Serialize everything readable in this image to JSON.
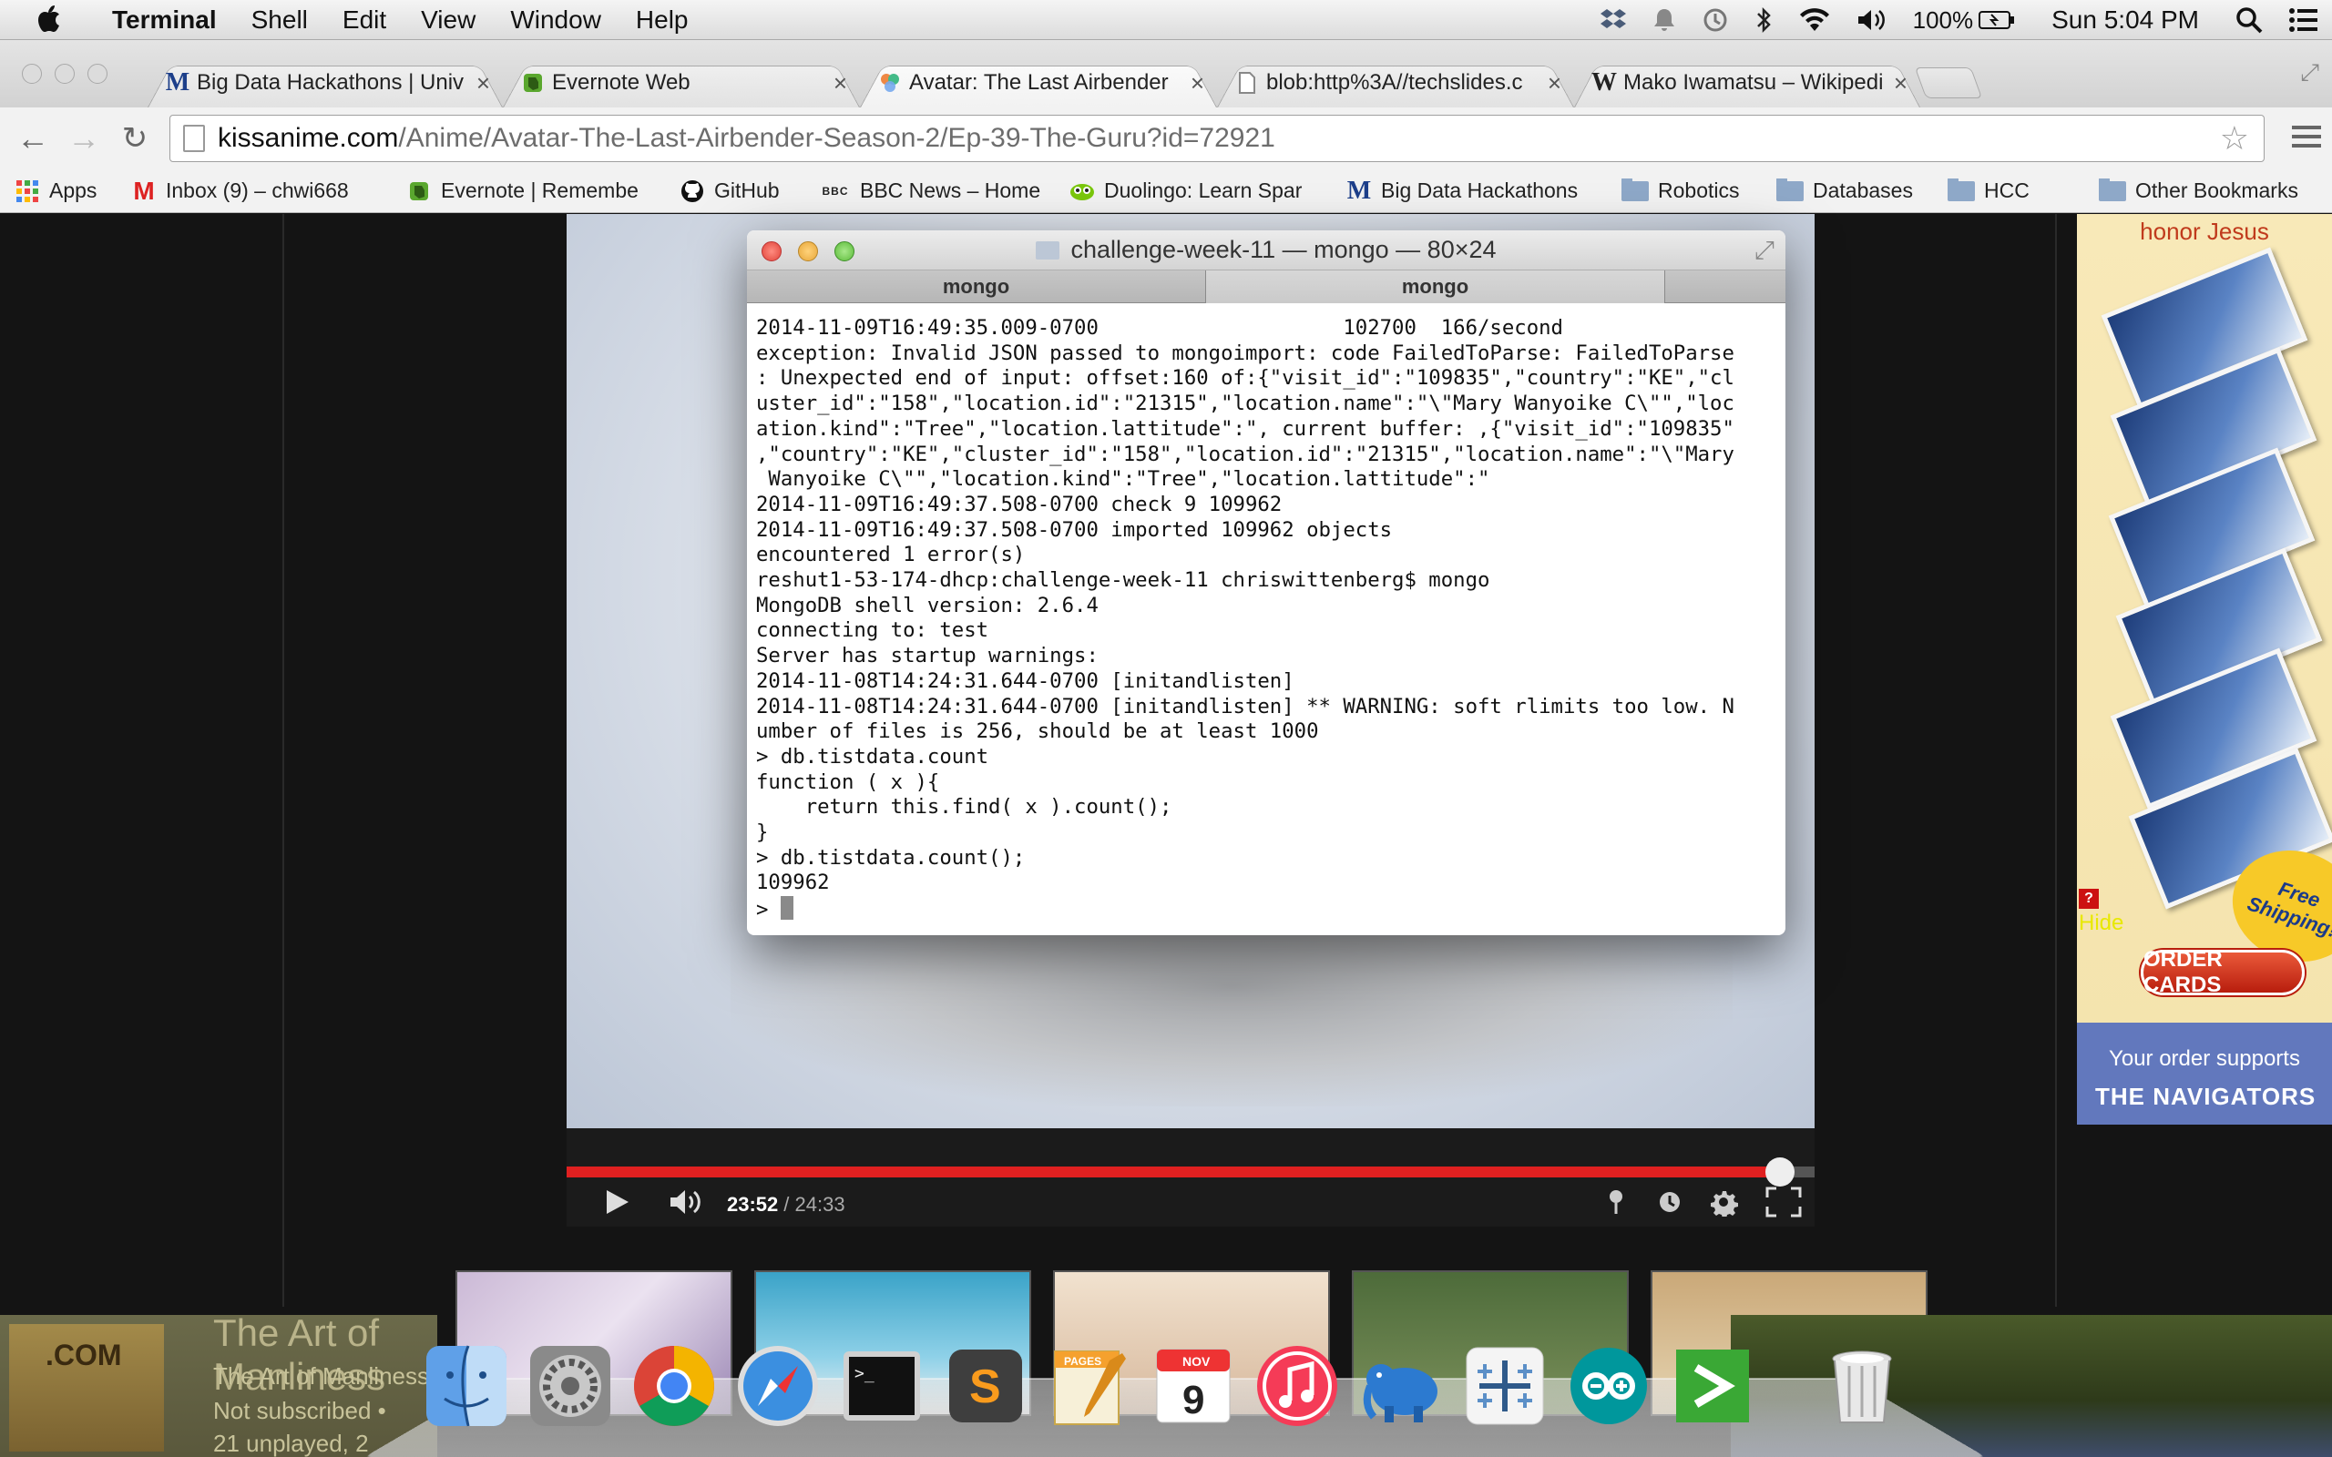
{
  "menubar": {
    "app_name": "Terminal",
    "menus": [
      "Shell",
      "Edit",
      "View",
      "Window",
      "Help"
    ],
    "battery": "100%",
    "clock": "Sun 5:04 PM"
  },
  "browser": {
    "tabs": [
      {
        "icon": "M",
        "title": "Big Data Hackathons | Univ"
      },
      {
        "icon": "evernote",
        "title": "Evernote Web"
      },
      {
        "icon": "avatar",
        "title": "Avatar: The Last Airbender"
      },
      {
        "icon": "page",
        "title": "blob:http%3A//techslides.c"
      },
      {
        "icon": "W",
        "title": "Mako Iwamatsu – Wikipedi"
      }
    ],
    "url_host": "kissanime.com",
    "url_path": "/Anime/Avatar-The-Last-Airbender-Season-2/Ep-39-The-Guru?id=72921",
    "bookmarks": [
      {
        "icon": "apps",
        "label": "Apps"
      },
      {
        "icon": "gmail",
        "label": "Inbox (9) – chwi668"
      },
      {
        "icon": "evernote",
        "label": "Evernote | Remembe"
      },
      {
        "icon": "github",
        "label": "GitHub"
      },
      {
        "icon": "bbc",
        "label": "BBC News – Home"
      },
      {
        "icon": "duolingo",
        "label": "Duolingo: Learn Spar"
      },
      {
        "icon": "M",
        "label": "Big Data Hackathons"
      }
    ],
    "bookmark_folders": [
      "Robotics",
      "Databases",
      "HCC"
    ],
    "other_bookmarks": "Other Bookmarks"
  },
  "player": {
    "current_time": "23:52",
    "duration": "/ 24:33",
    "progress": 0.9722
  },
  "terminal": {
    "title": "challenge-week-11 — mongo — 80×24",
    "tabs": [
      "mongo",
      "mongo"
    ],
    "lines": [
      "2014-11-09T16:49:35.009-0700                    102700  166/second",
      "exception: Invalid JSON passed to mongoimport: code FailedToParse: FailedToParse",
      ": Unexpected end of input: offset:160 of:{\"visit_id\":\"109835\",\"country\":\"KE\",\"cl",
      "uster_id\":\"158\",\"location.id\":\"21315\",\"location.name\":\"\\\"Mary Wanyoike C\\\"\",\"loc",
      "ation.kind\":\"Tree\",\"location.lattitude\":\", current buffer: ,{\"visit_id\":\"109835\"",
      ",\"country\":\"KE\",\"cluster_id\":\"158\",\"location.id\":\"21315\",\"location.name\":\"\\\"Mary",
      " Wanyoike C\\\"\",\"location.kind\":\"Tree\",\"location.lattitude\":\"",
      "2014-11-09T16:49:37.508-0700 check 9 109962",
      "2014-11-09T16:49:37.508-0700 imported 109962 objects",
      "encountered 1 error(s)",
      "reshut1-53-174-dhcp:challenge-week-11 chriswittenberg$ mongo",
      "MongoDB shell version: 2.6.4",
      "connecting to: test",
      "Server has startup warnings:",
      "2014-11-08T14:24:31.644-0700 [initandlisten]",
      "2014-11-08T14:24:31.644-0700 [initandlisten] ** WARNING: soft rlimits too low. N",
      "umber of files is 256, should be at least 1000",
      "> db.tistdata.count",
      "function ( x ){",
      "    return this.find( x ).count();",
      "}",
      "> db.tistdata.count();",
      "109962"
    ],
    "prompt": "> "
  },
  "ad": {
    "headline": "honor Jesus",
    "free_shipping": "Free Shipping!",
    "order_button": "ORDER CARDS",
    "support_text": "Your order supports",
    "org_name": "THE NAVIGATORS",
    "help_badge": "?",
    "hide_label": "Hide"
  },
  "background_page": {
    "channel_title": "The Art of Manliness",
    "channel_name": "The Art of Manliness",
    "subscription": "Not subscribed •",
    "unplayed": "21 unplayed, 2",
    "logo_text": ".COM"
  },
  "dock": {
    "apps": [
      "Finder",
      "System Preferences",
      "Google Chrome",
      "Safari",
      "Terminal",
      "Sublime Text",
      "Pages",
      "Calendar",
      "iTunes",
      "Sequel Pro",
      "Tableau",
      "Arduino",
      "Codeship",
      "Trash"
    ],
    "calendar_month": "NOV",
    "calendar_day": "9",
    "pages_label": "PAGES"
  },
  "colors": {
    "progress_red": "#e02020",
    "ad_red": "#c03a1c",
    "ad_blue": "#6278bd",
    "hide_yellow": "#e8e800"
  }
}
